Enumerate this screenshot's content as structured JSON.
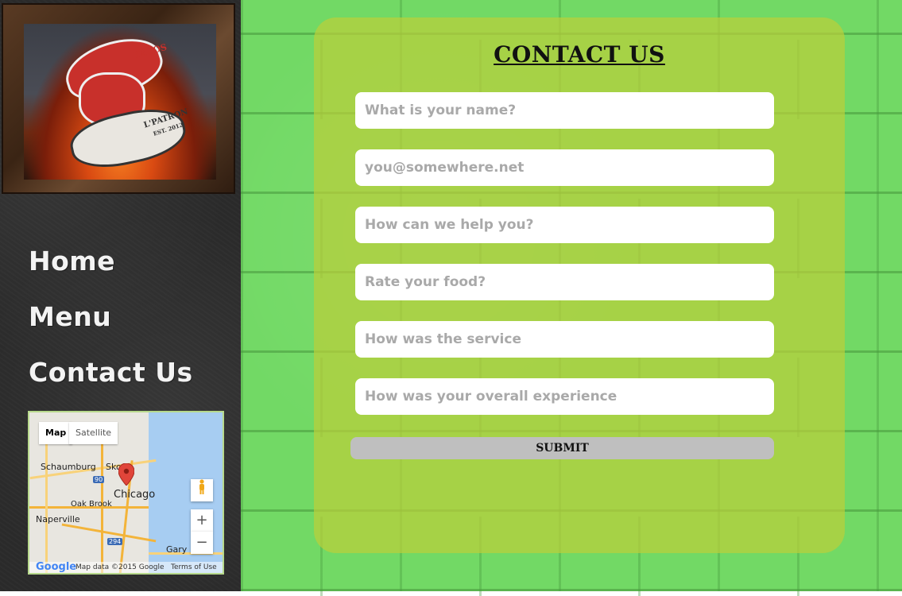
{
  "logo": {
    "alt_text_tacos": "TACOS",
    "alt_text_patron": "L'PATRON",
    "alt_text_est": "EST. 2012"
  },
  "nav": {
    "items": [
      {
        "label": "Home"
      },
      {
        "label": "Menu"
      },
      {
        "label": "Contact Us"
      }
    ]
  },
  "map": {
    "tabs": [
      "Map",
      "Satellite"
    ],
    "labels": {
      "schaumburg": "Schaumburg",
      "skokie": "Sko",
      "chicago": "Chicago",
      "oak_brook": "Oak Brook",
      "naperville": "Naperville",
      "gary": "Gary"
    },
    "shields": {
      "i90": "90",
      "i294": "294"
    },
    "zoom_in": "+",
    "zoom_out": "−",
    "google_logo": "Google",
    "map_data": "Map data ©2015 Google",
    "terms": "Terms of Use"
  },
  "form": {
    "title": "CONTACT US",
    "fields": [
      {
        "placeholder": "What is your name?",
        "value": ""
      },
      {
        "placeholder": "you@somewhere.net",
        "value": ""
      },
      {
        "placeholder": "How can we help you?",
        "value": ""
      },
      {
        "placeholder": "Rate your food?",
        "value": ""
      },
      {
        "placeholder": "How was the service",
        "value": ""
      },
      {
        "placeholder": "How was your overall experience",
        "value": ""
      }
    ],
    "submit_label": "SUBMIT"
  },
  "colors": {
    "sidebar_bg": "#2b2b2b",
    "wall_green": "#72d965",
    "panel_olive": "#bace3a",
    "submit_gray": "#bfbfbf",
    "pin_red": "#e0453a"
  }
}
